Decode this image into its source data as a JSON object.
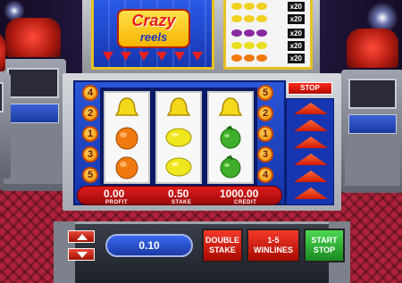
{
  "game": {
    "logo_line1": "Crazy",
    "logo_line2": "reels"
  },
  "paytable": [
    {
      "symbol": "bell-icon",
      "color": "#f0d020",
      "count": 3,
      "multiplier": "x20"
    },
    {
      "symbol": "bell-icon",
      "color": "#f0d020",
      "count": 3,
      "multiplier": "x20"
    },
    {
      "symbol": "grapes-icon",
      "color": "#8a2aa0",
      "count": 3,
      "multiplier": "x20"
    },
    {
      "symbol": "lemon-icon",
      "color": "#e8e020",
      "count": 3,
      "multiplier": "x20"
    },
    {
      "symbol": "orange-icon",
      "color": "#f07a10",
      "count": 3,
      "multiplier": "x20"
    }
  ],
  "reels": [
    [
      "bell-icon",
      "orange-icon",
      "orange-icon"
    ],
    [
      "bell-icon",
      "lemon-icon",
      "lemon-icon"
    ],
    [
      "bell-icon",
      "melon-icon",
      "melon-icon"
    ]
  ],
  "left_lines": [
    "4",
    "2",
    "1",
    "3",
    "5"
  ],
  "right_lines": [
    "5",
    "2",
    "1",
    "3",
    "4"
  ],
  "stop_label": "STOP",
  "display": {
    "profit_value": "0.00",
    "profit_label": "PROFIT",
    "stake_value": "0.50",
    "stake_label": "STAKE",
    "credit_value": "1000.00",
    "credit_label": "CREDIT"
  },
  "controls": {
    "bet_value": "0.10",
    "double_stake_line1": "DOUBLE",
    "double_stake_line2": "STAKE",
    "winlines_line1": "1-5",
    "winlines_line2": "WINLINES",
    "start_line1": "START",
    "start_line2": "STOP"
  },
  "colors": {
    "reel_blue": "#1f4bd6",
    "display_red": "#d01414",
    "gold": "#e8c020",
    "start_green": "#2aa83a"
  }
}
